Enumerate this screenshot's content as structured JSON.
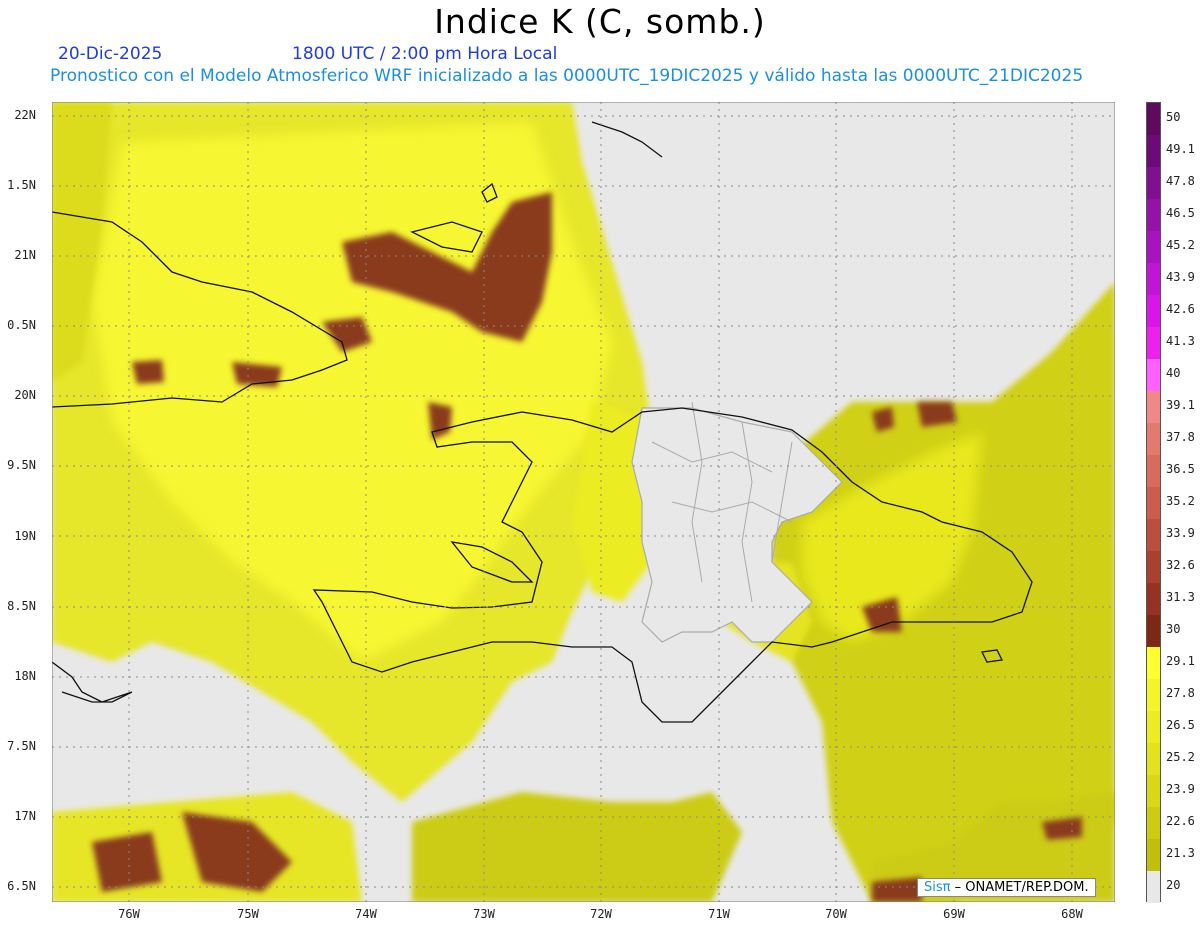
{
  "header": {
    "title": "Indice K (C, somb.)",
    "date": "20-Dic-2025",
    "time": "1800 UTC / 2:00 pm Hora Local",
    "model_info": "Pronostico con el Modelo Atmosferico WRF inicializado a las 0000UTC_19DIC2025 y válido hasta las  0000UTC_21DIC2025"
  },
  "map": {
    "lat_labels": [
      "22N",
      "1.5N",
      "21N",
      "0.5N",
      "20N",
      "9.5N",
      "19N",
      "8.5N",
      "18N",
      "7.5N",
      "17N",
      "6.5N"
    ],
    "lon_labels": [
      "76W",
      "75W",
      "74W",
      "73W",
      "72W",
      "71W",
      "70W",
      "69W",
      "68W"
    ],
    "background_color": "#e8e8e8"
  },
  "colorbar": {
    "labels": [
      "50",
      "49.1",
      "47.8",
      "46.5",
      "45.2",
      "43.9",
      "42.6",
      "41.3",
      "40",
      "39.1",
      "37.8",
      "36.5",
      "35.2",
      "33.9",
      "32.6",
      "31.3",
      "30",
      "29.1",
      "27.8",
      "26.5",
      "25.2",
      "23.9",
      "22.6",
      "21.3",
      "20"
    ],
    "colors": [
      "#5e0a5e",
      "#6e0a78",
      "#80108f",
      "#9412a8",
      "#a812bf",
      "#c014d6",
      "#d816e8",
      "#ee20ee",
      "#ff60ff",
      "#f08888",
      "#e27a70",
      "#d86a5e",
      "#cc5c4e",
      "#bc4e3e",
      "#aa4030",
      "#963222",
      "#7e2814",
      "#ffff30",
      "#f4f42a",
      "#ecec24",
      "#e2e21e",
      "#d8d818",
      "#cccc12",
      "#c0c00c",
      "#e8e8e8"
    ]
  },
  "credit": {
    "brand": "Sisπ",
    "text": " – ONAMET/REP.DOM."
  }
}
